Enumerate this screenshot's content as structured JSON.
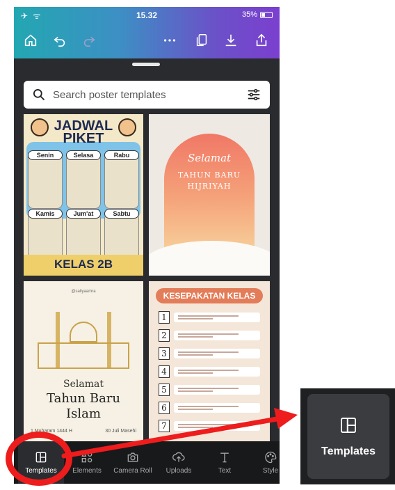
{
  "status_bar": {
    "left": "✈ ᯤ",
    "time": "15.32",
    "battery": "35%"
  },
  "search": {
    "placeholder": "Search poster templates"
  },
  "templates": {
    "jadwal": {
      "title_line1": "JADWAL",
      "title_line2": "PIKET",
      "days": [
        "Senin",
        "Selasa",
        "Rabu",
        "Kamis",
        "Jum'at",
        "Sabtu"
      ],
      "footer": "KELAS 2B"
    },
    "hijriyah": {
      "script": "Selamat",
      "line1": "TAHUN BARU",
      "line2": "HIJRIYAH"
    },
    "islam": {
      "small": "@saliyaamra",
      "line1": "Selamat",
      "line2": "Tahun Baru",
      "line3": "Islam",
      "date_left": "1 Muharam 1444 H",
      "date_right": "30 Juli Masehi"
    },
    "kesepakatan": {
      "title": "KESEPAKATAN KELAS",
      "numbers": [
        "1",
        "2",
        "3",
        "4",
        "5",
        "6",
        "7"
      ]
    }
  },
  "nav": {
    "items": [
      {
        "label": "Templates",
        "icon": "templates-icon",
        "active": true
      },
      {
        "label": "Elements",
        "icon": "elements-icon"
      },
      {
        "label": "Camera Roll",
        "icon": "camera-icon"
      },
      {
        "label": "Uploads",
        "icon": "upload-icon"
      },
      {
        "label": "Text",
        "icon": "text-icon"
      },
      {
        "label": "Style",
        "icon": "palette-icon"
      }
    ]
  },
  "zoom_callout": {
    "label": "Templates"
  },
  "colors": {
    "annotation_red": "#ee1c1c",
    "accent_gradient_start": "#23a7b2",
    "accent_gradient_end": "#7b3fcf"
  }
}
